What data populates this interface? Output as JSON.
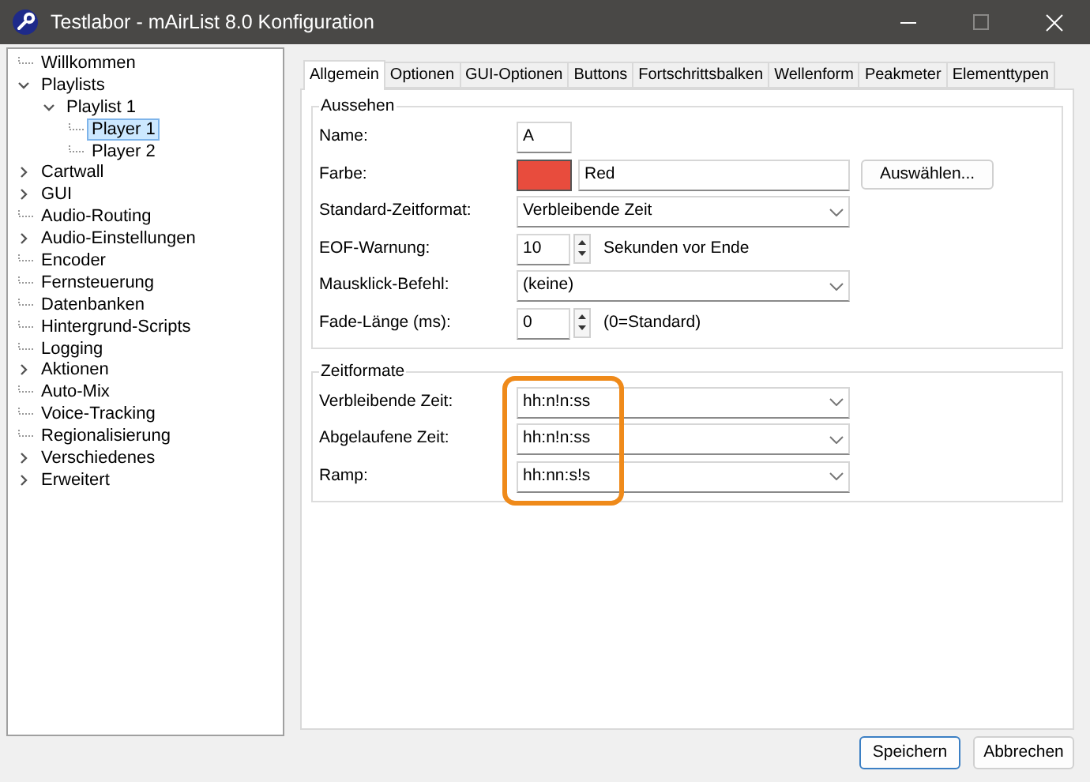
{
  "window": {
    "title": "Testlabor - mAirList 8.0 Konfiguration"
  },
  "tree": [
    {
      "label": "Willkommen",
      "kind": "leaf",
      "selected": false
    },
    {
      "label": "Playlists",
      "kind": "folder",
      "expanded": true,
      "selected": false,
      "children": [
        {
          "label": "Playlist 1",
          "kind": "folder",
          "expanded": true,
          "selected": false,
          "children": [
            {
              "label": "Player 1",
              "kind": "leaf",
              "selected": true
            },
            {
              "label": "Player 2",
              "kind": "leaf",
              "selected": false
            }
          ]
        }
      ]
    },
    {
      "label": "Cartwall",
      "kind": "folder",
      "expanded": false,
      "selected": false
    },
    {
      "label": "GUI",
      "kind": "folder",
      "expanded": false,
      "selected": false
    },
    {
      "label": "Audio-Routing",
      "kind": "leaf",
      "selected": false
    },
    {
      "label": "Audio-Einstellungen",
      "kind": "folder",
      "expanded": false,
      "selected": false
    },
    {
      "label": "Encoder",
      "kind": "leaf",
      "selected": false
    },
    {
      "label": "Fernsteuerung",
      "kind": "leaf",
      "selected": false
    },
    {
      "label": "Datenbanken",
      "kind": "leaf",
      "selected": false
    },
    {
      "label": "Hintergrund-Scripts",
      "kind": "leaf",
      "selected": false
    },
    {
      "label": "Logging",
      "kind": "leaf",
      "selected": false
    },
    {
      "label": "Aktionen",
      "kind": "folder",
      "expanded": false,
      "selected": false
    },
    {
      "label": "Auto-Mix",
      "kind": "leaf",
      "selected": false
    },
    {
      "label": "Voice-Tracking",
      "kind": "leaf",
      "selected": false
    },
    {
      "label": "Regionalisierung",
      "kind": "leaf",
      "selected": false
    },
    {
      "label": "Verschiedenes",
      "kind": "folder",
      "expanded": false,
      "selected": false
    },
    {
      "label": "Erweitert",
      "kind": "folder",
      "expanded": false,
      "selected": false
    }
  ],
  "tabs": [
    {
      "label": "Allgemein",
      "selected": true
    },
    {
      "label": "Optionen",
      "selected": false
    },
    {
      "label": "GUI-Optionen",
      "selected": false
    },
    {
      "label": "Buttons",
      "selected": false
    },
    {
      "label": "Fortschrittsbalken",
      "selected": false
    },
    {
      "label": "Wellenform",
      "selected": false
    },
    {
      "label": "Peakmeter",
      "selected": false
    },
    {
      "label": "Elementtypen",
      "selected": false
    }
  ],
  "groups": [
    {
      "title": "Aussehen",
      "highlighted": false,
      "rows": [
        {
          "kind": "text",
          "label": "Name:",
          "value": "A"
        },
        {
          "kind": "color",
          "label": "Farbe:",
          "color": "#e84c3d",
          "value": "Red",
          "button": "Auswählen..."
        },
        {
          "kind": "combo",
          "label": "Standard-Zeitformat:",
          "value": "Verbleibende Zeit"
        },
        {
          "kind": "spin",
          "label": "EOF-Warnung:",
          "value": "10",
          "suffix": "Sekunden vor Ende"
        },
        {
          "kind": "combo",
          "label": "Mausklick-Befehl:",
          "value": "(keine)"
        },
        {
          "kind": "spin",
          "label": "Fade-Länge (ms):",
          "value": "0",
          "suffix": "(0=Standard)"
        }
      ]
    },
    {
      "title": "Zeitformate",
      "highlighted": true,
      "rows": [
        {
          "kind": "combo",
          "label": "Verbleibende Zeit:",
          "value": "hh:n!n:ss"
        },
        {
          "kind": "combo",
          "label": "Abgelaufene Zeit:",
          "value": "hh:n!n:ss"
        },
        {
          "kind": "combo",
          "label": "Ramp:",
          "value": "hh:nn:s!s"
        }
      ]
    }
  ],
  "buttons": [
    {
      "label": "Speichern",
      "default": true
    },
    {
      "label": "Abbrechen",
      "default": false
    }
  ]
}
